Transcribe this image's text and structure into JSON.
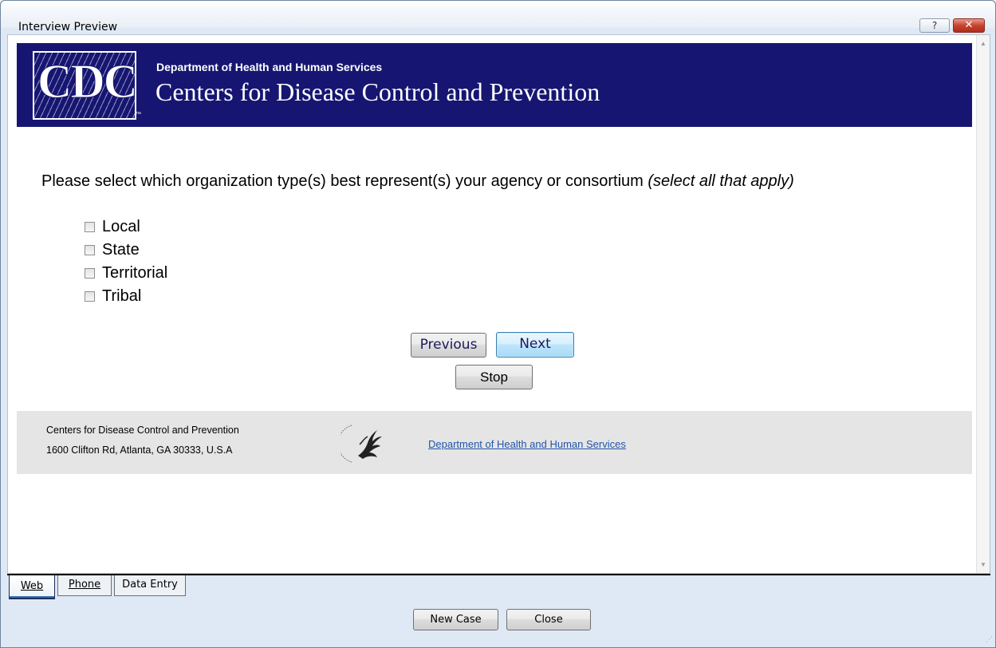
{
  "window": {
    "title": "Interview Preview",
    "help_glyph": "?",
    "close_glyph": "✕"
  },
  "banner": {
    "logo_text": "CDC",
    "trademark": "™",
    "department": "Department of Health and Human Services",
    "agency": "Centers for Disease Control and Prevention",
    "background_color": "#161672"
  },
  "question": {
    "text": "Please select which organization type(s) best represent(s) your agency or consortium ",
    "hint": "(select all that apply)",
    "options": [
      {
        "label": "Local",
        "checked": false
      },
      {
        "label": "State",
        "checked": false
      },
      {
        "label": "Territorial",
        "checked": false
      },
      {
        "label": "Tribal",
        "checked": false
      }
    ]
  },
  "navigation": {
    "previous_label": "Previous",
    "next_label": "Next",
    "stop_label": "Stop"
  },
  "footer": {
    "org_name": "Centers for Disease Control and Prevention",
    "address": "1600 Clifton Rd, Atlanta, GA 30333, U.S.A",
    "link_text": "Department of Health and Human Services",
    "link_color": "#2255aa"
  },
  "tabs": [
    {
      "label": "Web",
      "selected": true
    },
    {
      "label": "Phone",
      "selected": false
    },
    {
      "label": "Data Entry",
      "selected": false
    }
  ],
  "bottom_buttons": {
    "new_case_label": "New Case",
    "close_label": "Close"
  }
}
